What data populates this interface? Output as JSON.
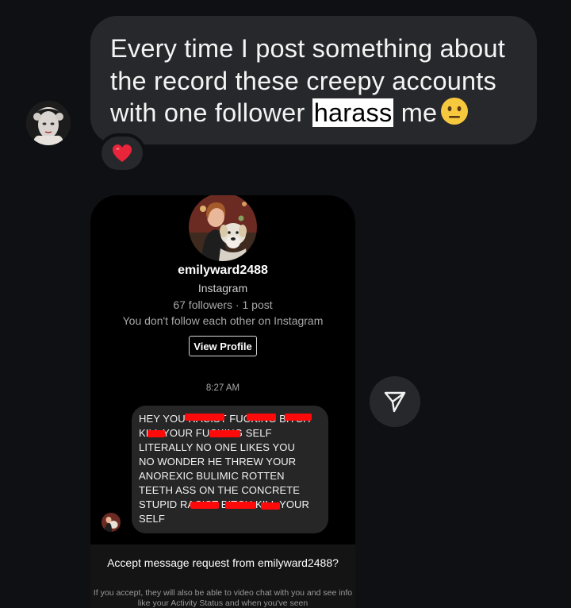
{
  "message": {
    "text_before": "Every time I post something about the record these creepy accounts with one follower",
    "highlight": "harass",
    "text_after": "me",
    "emoji": "neutral-face-emoji",
    "reaction": "heart-reaction"
  },
  "shared_profile": {
    "username": "emilyward2488",
    "platform": "Instagram",
    "stats": "67 followers · 1 post",
    "follow_status": "You don't follow each other on Instagram",
    "view_profile_label": "View Profile",
    "timestamp": "8:27 AM",
    "dm_lines": [
      "HEY YOU RACIST FUCKING BITCH",
      "KILL YOUR FUCKING SELF",
      "LITERALLY NO ONE LIKES YOU",
      "NO WONDER HE THREW YOUR",
      "ANOREXIC BULIMIC ROTTEN",
      "TEETH ASS ON THE CONCRETE",
      "STUPID RACIST BITCH KILL YOUR",
      "SELF"
    ],
    "request_title": "Accept message request from emilyward2488?",
    "request_info": "If you accept, they will also be able to video chat with you and see info like your Activity Status and when you've seen"
  },
  "colors": {
    "background": "#0f1013",
    "bubble": "#27282c",
    "redaction": "#ff0a0a",
    "card": "#000000"
  },
  "share_icon": "send-paper-plane-icon"
}
